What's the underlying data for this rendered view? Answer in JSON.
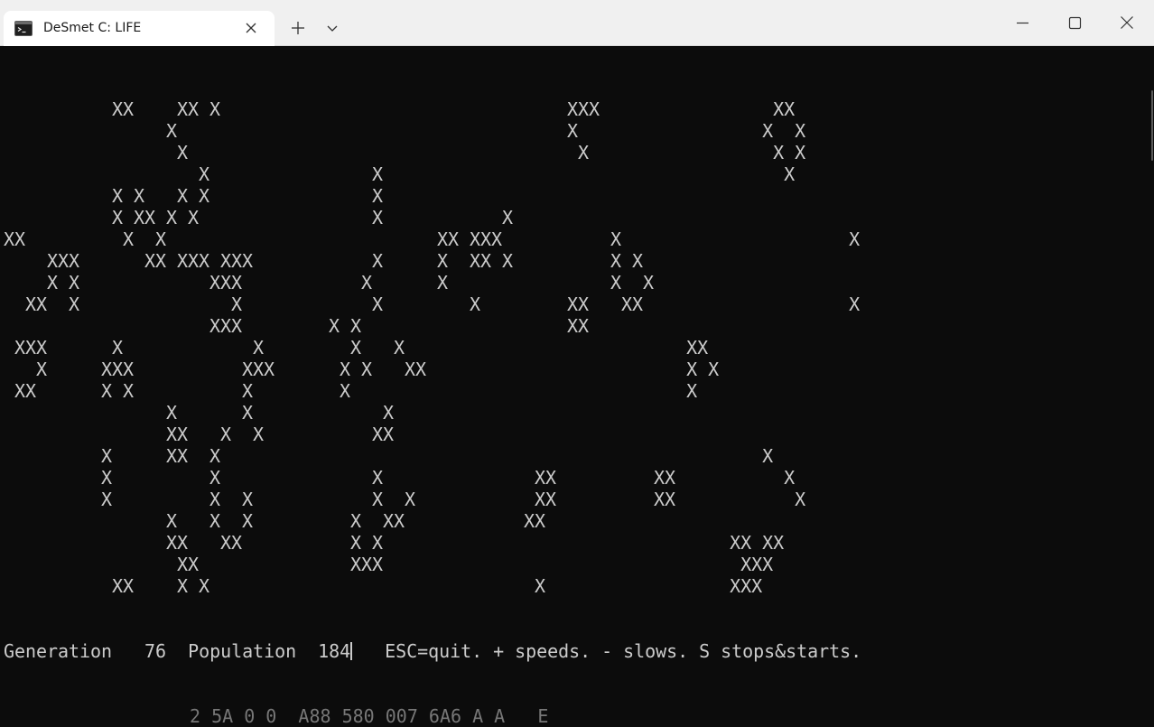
{
  "window": {
    "tab_title": "DeSmet C: LIFE",
    "tab_icon": "terminal-icon"
  },
  "controls": {
    "new_tab_icon": "plus-icon",
    "dropdown_icon": "chevron-down-icon",
    "minimize_icon": "minimize-icon",
    "maximize_icon": "maximize-icon",
    "close_icon": "close-icon"
  },
  "terminal": {
    "lines": [
      "          XX    XX X                                XXX                XX",
      "               X                                    X                 X  X",
      "                X                                    X                 X X",
      "                  X               X                                     X",
      "          X X   X X               X",
      "          X XX X X                X           X",
      "XX         X  X                         XX XXX          X                     X",
      "    XXX      XX XXX XXX           X     X  XX X         X X",
      "    X X            XXX           X      X               X  X",
      "  XX  X              X            X        X        XX   XX                   X",
      "                   XXX        X X                   XX",
      " XXX      X            X        X   X                          XX",
      "   X     XXX          XXX      X X   XX                        X X",
      " XX      X X          X        X                               X",
      "               X      X            X",
      "               XX   X  X          XX",
      "         X     XX  X                                                  X",
      "         X         X              X              XX         XX          X",
      "         X         X  X           X  X           XX         XX           X",
      "               X   X  X         X  XX           XX",
      "               XX   XX          X X                                XX XX",
      "                XX              XXX                                 XXX",
      "          XX    X X                              X                 XXX"
    ],
    "status": {
      "generation_label": "Generation",
      "generation": "76",
      "population_label": "Population",
      "population": "184",
      "help": "ESC=quit. + speeds. - slows. S stops&starts."
    },
    "ghost_text": "2 5A 0 0  A88 580 007 6A6 A A   E"
  },
  "colors": {
    "background": "#0c0c0c",
    "foreground": "#cccccc",
    "titlebar": "#f0f0f0",
    "tab_active": "#ffffff"
  }
}
